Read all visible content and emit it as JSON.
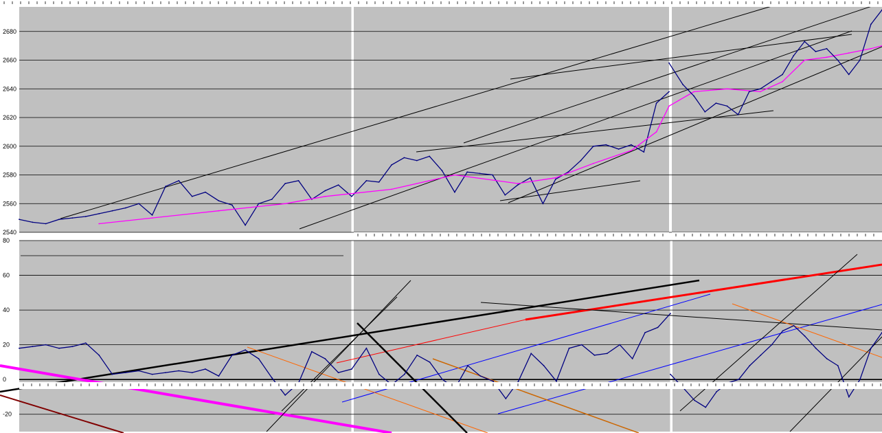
{
  "chart_data": [
    {
      "type": "line",
      "id": "top",
      "ylim": [
        2540,
        2700
      ],
      "yticks": [
        "2540",
        "2560",
        "2580",
        "2600",
        "2620",
        "2640",
        "2660",
        "2680",
        "2700"
      ],
      "grid": true,
      "background": "#c0c0c0",
      "series": [
        {
          "color": "#000080",
          "x": [
            0,
            2,
            4,
            6,
            8,
            10,
            12,
            14,
            16,
            18,
            20,
            22,
            24,
            26,
            28,
            30,
            32,
            34,
            36,
            38,
            40,
            42,
            44,
            46,
            48,
            50,
            52,
            54,
            56,
            58,
            60,
            62,
            64,
            66,
            68,
            70,
            72,
            74,
            76,
            78,
            80,
            82,
            84,
            86,
            88,
            90,
            92,
            94,
            96,
            98,
            100
          ],
          "y": [
            2549,
            2547,
            2546,
            2549,
            2550,
            2551,
            2553,
            2555,
            2557,
            2560,
            2552,
            2572,
            2576,
            2565,
            2568,
            2562,
            2559,
            2545,
            2560,
            2563,
            2574,
            2576,
            2563,
            2569,
            2573,
            2565,
            2576,
            2575,
            2587,
            2592,
            2590,
            2593,
            2583,
            2568,
            2582,
            2581,
            2580,
            2566,
            2573,
            2578,
            2560,
            2577,
            2582,
            2590,
            2600,
            2601,
            2598,
            2601,
            2596,
            2630,
            2638
          ]
        },
        {
          "color": "#ff00ff",
          "x": [
            12,
            20,
            30,
            40,
            46,
            56,
            66,
            76,
            82,
            88,
            94,
            98,
            100,
            104,
            110,
            116,
            120,
            124,
            128,
            132,
            136,
            138
          ],
          "y": [
            2546,
            2550,
            2555,
            2560,
            2565,
            2570,
            2580,
            2574,
            2578,
            2588,
            2597,
            2610,
            2628,
            2638,
            2640,
            2638,
            2645,
            2660,
            2662,
            2665,
            2668,
            2670
          ],
          "xs": "pane"
        },
        {
          "color": "#000080",
          "x": [
            100,
            102,
            104,
            106,
            108,
            110,
            112,
            114,
            116,
            118,
            120,
            122,
            124,
            126,
            128,
            130,
            132,
            134,
            136,
            138
          ],
          "y": [
            2658,
            2643,
            2635,
            2624,
            2630,
            2628,
            2622,
            2638,
            2640,
            2645,
            2650,
            2663,
            2673,
            2666,
            2668,
            2660,
            2650,
            2660,
            2685,
            2695
          ]
        }
      ]
    },
    {
      "type": "line",
      "id": "bottom",
      "ylim": [
        -30,
        80
      ],
      "yticks": [
        "80",
        "60",
        "40",
        "20",
        "0",
        "-20"
      ],
      "grid": true,
      "background": "#c0c0c0",
      "series": [
        {
          "color": "#000080",
          "x": [
            0,
            2,
            4,
            6,
            8,
            10,
            12,
            14,
            16,
            18,
            20,
            22,
            24,
            26,
            28,
            30,
            32,
            34,
            36,
            38,
            40,
            42,
            44,
            46,
            48,
            50,
            52,
            54,
            56,
            58,
            60,
            62,
            64,
            66,
            68,
            70,
            72,
            74,
            76,
            78,
            80,
            82,
            84,
            86,
            88,
            90,
            92,
            94,
            96,
            98,
            100
          ],
          "y": [
            18,
            19,
            20,
            18,
            19,
            21,
            14,
            3,
            4,
            5,
            3,
            4,
            5,
            4,
            6,
            2,
            14,
            17,
            12,
            1,
            -9,
            -2,
            16,
            12,
            4,
            6,
            18,
            3,
            -3,
            3,
            14,
            10,
            0,
            -5,
            8,
            2,
            -1,
            -11,
            -1,
            15,
            8,
            -1,
            18,
            20,
            14,
            15,
            20,
            12,
            27,
            30,
            38
          ]
        },
        {
          "color": "#000080",
          "x": [
            100,
            102,
            104,
            106,
            108,
            110,
            112,
            114,
            116,
            118,
            120,
            122,
            124,
            126,
            128,
            130,
            132,
            134,
            136,
            138
          ],
          "y": [
            3,
            -5,
            -12,
            -16,
            -7,
            -2,
            0,
            8,
            14,
            20,
            28,
            31,
            25,
            18,
            12,
            8,
            -10,
            0,
            18,
            27
          ]
        }
      ]
    }
  ]
}
